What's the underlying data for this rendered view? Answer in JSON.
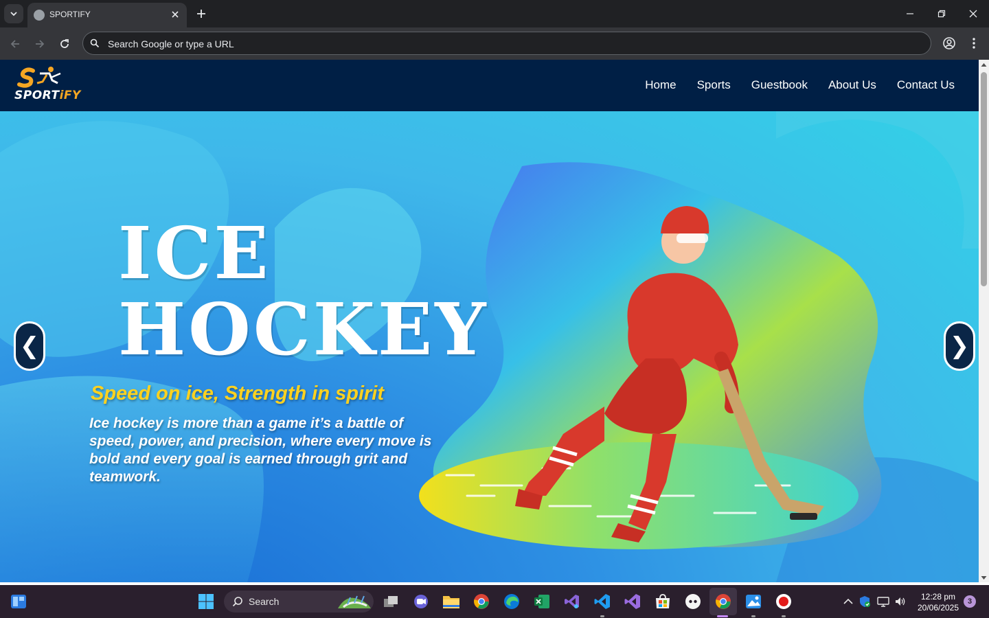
{
  "browser": {
    "tab_title": "SPORTIFY",
    "omnibox_placeholder": "Search Google or type a URL"
  },
  "site": {
    "logo_text_main": "SPORT",
    "logo_text_accent": "iFY",
    "nav": [
      "Home",
      "Sports",
      "Guestbook",
      "About Us",
      "Contact Us"
    ]
  },
  "hero": {
    "title_line_1": "ICE",
    "title_line_2": "HOCKEY",
    "tagline": "Speed on ice, Strength in spirit",
    "description": "Ice hockey is more than a game it’s a battle of speed, power, and precision, where every move is bold and every goal is earned through grit and teamwork.",
    "prev_glyph": "❮",
    "next_glyph": "❯"
  },
  "taskbar": {
    "search_label": "Search",
    "time": "12:28 pm",
    "date": "20/06/2025",
    "notification_count": "3"
  },
  "colors": {
    "nav_bg": "#001f45",
    "accent_yellow": "#ffd21f",
    "logo_orange": "#f5a623"
  }
}
